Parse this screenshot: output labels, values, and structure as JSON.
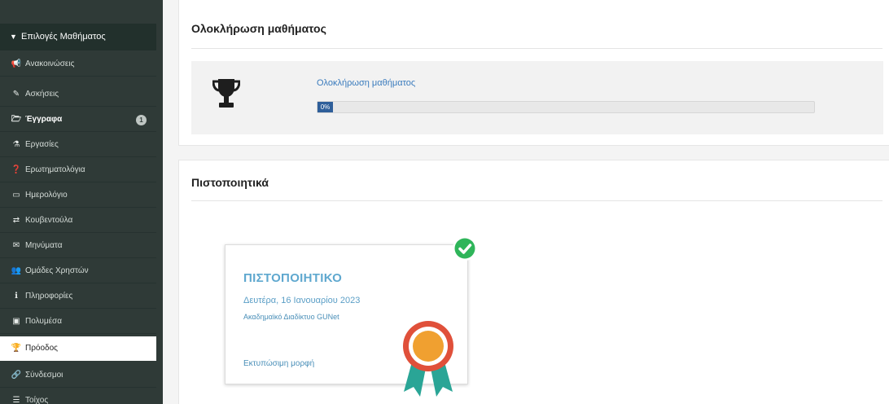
{
  "sidebar": {
    "header_label": "Επιλογές Μαθήματος",
    "items": [
      {
        "label": "Ανακοινώσεις",
        "icon": "bullhorn-icon",
        "glyph": "📢"
      },
      {
        "label": "Ασκήσεις",
        "icon": "edit-icon",
        "glyph": "✎"
      },
      {
        "label": "Έγγραφα",
        "icon": "folder-open-icon",
        "glyph": "🗁",
        "badge": "1"
      },
      {
        "label": "Εργασίες",
        "icon": "flask-icon",
        "glyph": "⚗"
      },
      {
        "label": "Ερωτηματολόγια",
        "icon": "question-circle-icon",
        "glyph": "❓"
      },
      {
        "label": "Ημερολόγιο",
        "icon": "calendar-icon",
        "glyph": "▭"
      },
      {
        "label": "Κουβεντούλα",
        "icon": "exchange-icon",
        "glyph": "⇄"
      },
      {
        "label": "Μηνύματα",
        "icon": "envelope-icon",
        "glyph": "✉"
      },
      {
        "label": "Ομάδες Χρηστών",
        "icon": "users-icon",
        "glyph": "👥"
      },
      {
        "label": "Πληροφορίες",
        "icon": "info-circle-icon",
        "glyph": "ℹ"
      },
      {
        "label": "Πολυμέσα",
        "icon": "film-icon",
        "glyph": "▣"
      },
      {
        "label": "Πρόοδος",
        "icon": "trophy-icon",
        "glyph": "🏆"
      },
      {
        "label": "Σύνδεσμοι",
        "icon": "link-icon",
        "glyph": "🔗"
      },
      {
        "label": "Τοίχος",
        "icon": "list-icon",
        "glyph": "☰"
      }
    ]
  },
  "completion": {
    "title": "Ολοκλήρωση μαθήματος",
    "link_label": "Ολοκλήρωση μαθήματος",
    "progress": 0,
    "progress_label": "0%",
    "icon": "trophy-icon"
  },
  "certificates": {
    "title": "Πιστοποιητικά",
    "card": {
      "heading": "ΠΙΣΤΟΠΟΙΗΤΙΚΟ",
      "date": "Δευτέρα, 16 Ιανουαρίου 2023",
      "issuer": "Ακαδημαϊκό Διαδίκτυο GUNet",
      "print_link": "Εκτυπώσιμη μορφή",
      "status_icon": "check-circle-icon",
      "badge_icon": "award-ribbon-icon"
    }
  },
  "colors": {
    "sidebar_bg": "#2f3a37",
    "link": "#3a7bbd",
    "progress_fill": "#2f5f9a",
    "cert_accent": "#5fa8cf",
    "check_green": "#2fb55a",
    "medal_orange": "#f0a030",
    "ribbon_teal": "#2aa596"
  }
}
